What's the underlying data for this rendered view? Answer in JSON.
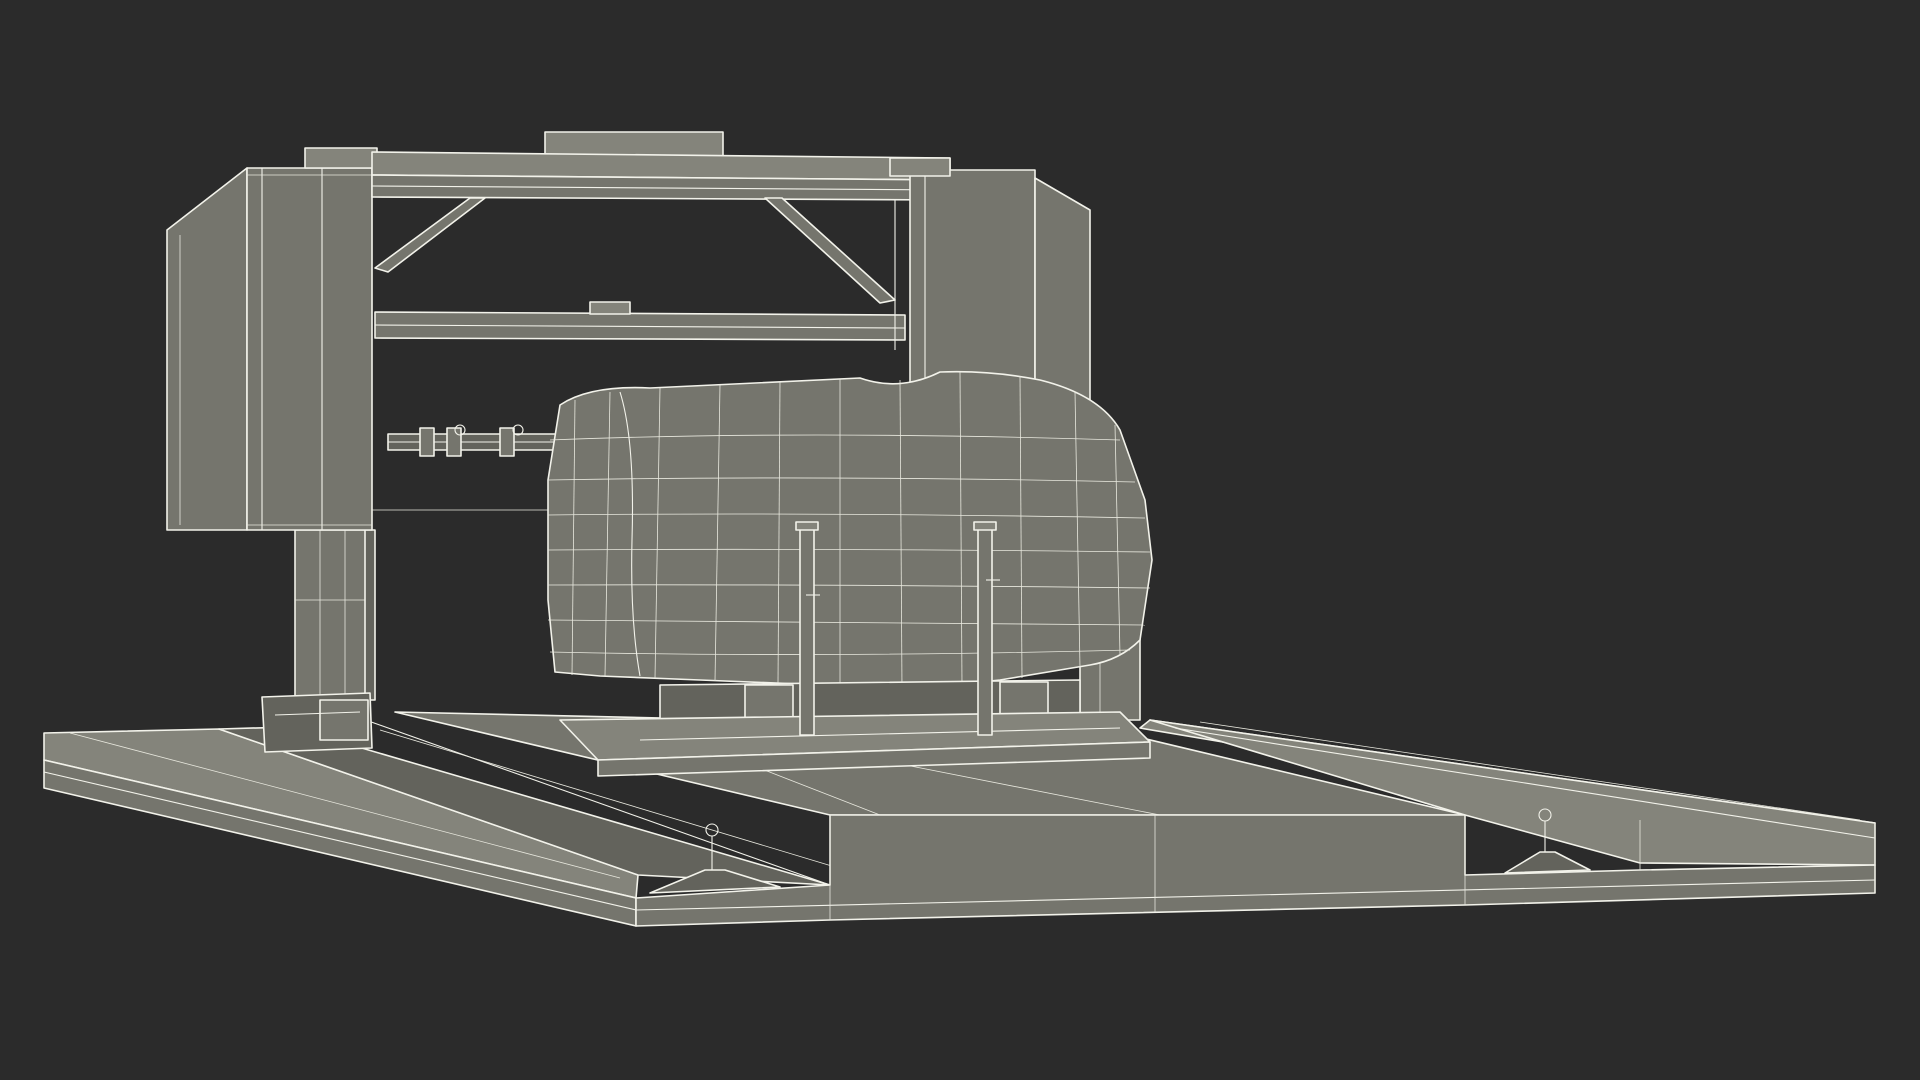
{
  "scene": {
    "subject": "sawmill-wireframe-render",
    "colors": {
      "background": "#2b2b2b",
      "surface": "#75756d",
      "surface_dark": "#63635c",
      "wire": "#f2f2ea"
    }
  }
}
